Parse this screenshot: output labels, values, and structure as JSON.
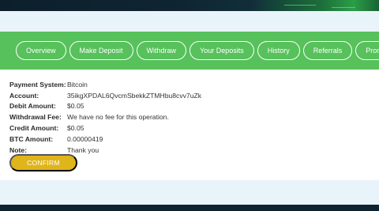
{
  "nav": {
    "items": [
      {
        "label": "Overview"
      },
      {
        "label": "Make Deposit"
      },
      {
        "label": "Withdraw"
      },
      {
        "label": "Your Deposits"
      },
      {
        "label": "History"
      },
      {
        "label": "Referrals"
      },
      {
        "label": "Promo"
      }
    ]
  },
  "withdrawal": {
    "payment_system": {
      "label": "Payment System:",
      "value": "Bitcoin"
    },
    "account": {
      "label": "Account:",
      "value": "35ikgXPDAL6QvcmSbekkZTMHbu8cvv7uZk"
    },
    "debit_amount": {
      "label": "Debit Amount:",
      "value": "$0.05"
    },
    "withdrawal_fee": {
      "label": "Withdrawal Fee:",
      "value": "We have no fee for this operation."
    },
    "credit_amount": {
      "label": "Credit Amount:",
      "value": "$0.05"
    },
    "btc_amount": {
      "label": "BTC Amount:",
      "value": "0.00000419"
    },
    "note": {
      "label": "Note:",
      "value": "Thank you"
    }
  },
  "confirm_label": "CONFIRM",
  "colors": {
    "nav_green": "#57c15b",
    "confirm_yellow": "#e0b51c",
    "page_bg": "#e9f3fa",
    "banner_dark": "#0d1f2c"
  }
}
